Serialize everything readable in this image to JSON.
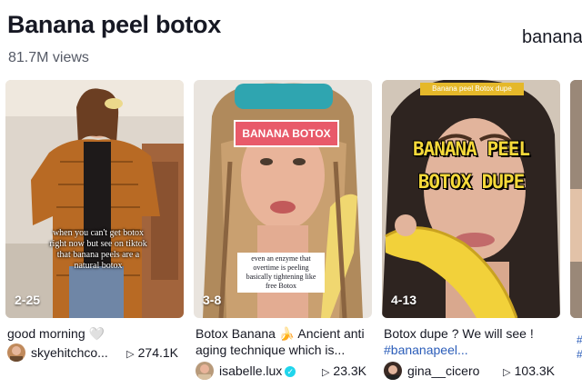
{
  "header": {
    "title": "Banana peel botox",
    "views": "81.7M views",
    "next_search_partial": "banana"
  },
  "videos": [
    {
      "date": "2-25",
      "overlay": "when you can't get botox right now but see on tiktok that banana peels are a natural botox",
      "caption": "good morning 🤍",
      "username": "skyehitchco...",
      "plays": "274.1K"
    },
    {
      "date": "3-8",
      "banner": "BANANA BOTOX",
      "overlay": "even an enzyme that overtime is peeling basically tightening like free Botox",
      "caption": "Botox Banana 🍌 Ancient anti aging technique which is...",
      "username": "isabelle.lux",
      "plays": "23.3K"
    },
    {
      "date": "4-13",
      "top_label": "Banana peel Botox dupe",
      "banner_line1": "BANANA PEEL",
      "banner_line2": "BOTOX DUPE",
      "caption": "Botox dupe ? We will see !",
      "hashtag": "#bananapeel...",
      "username": "gina__cicero",
      "plays": "103.3K"
    }
  ],
  "partial_card": {
    "caption_fragment": "#"
  },
  "icons": {
    "play": "play-icon",
    "verified": "verified-badge-icon"
  },
  "colors": {
    "hashtag": "#2b5db9",
    "banner_red": "#e85a6a",
    "banner_yellow": "#f5d93a"
  }
}
